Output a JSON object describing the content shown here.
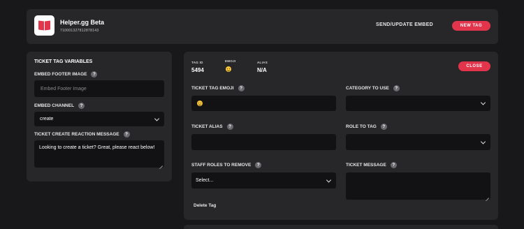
{
  "header": {
    "app_title": "Helper.gg Beta",
    "app_id": "710001327812878143",
    "send_label": "SEND/UPDATE EMBED",
    "new_tag_label": "NEW TAG"
  },
  "variables": {
    "title": "TICKET TAG VARIABLES",
    "footer_image": {
      "label": "EMBED FOOTER IMAGE",
      "placeholder": "Embed Footer Image"
    },
    "channel": {
      "label": "EMBED CHANNEL",
      "value": "create"
    },
    "reaction_message": {
      "label": "TICKET CREATE REACTION MESSAGE",
      "value": "Looking to create a ticket? Great, please react below!"
    }
  },
  "tag": {
    "id_label": "TAG ID",
    "id_value": "5494",
    "emoji_label": "EMOJI",
    "alias_label": "ALIAS",
    "alias_value": "N/A",
    "close_label": "CLOSE",
    "emoji_field_label": "TICKET TAG EMOJI",
    "category_label": "CATEGORY TO USE",
    "alias_field_label": "TICKET ALIAS",
    "role_label": "ROLE TO TAG",
    "staff_label": "STAFF ROLES TO REMOVE",
    "staff_value": "Select...",
    "message_label": "TICKET MESSAGE",
    "delete_label": "Delete Tag"
  },
  "icons": {
    "help": "?",
    "emoji": "grinning-face-emoji"
  },
  "colors": {
    "accent": "#e2354c",
    "panel": "#27272a",
    "background": "#18181a",
    "field": "#121214"
  }
}
